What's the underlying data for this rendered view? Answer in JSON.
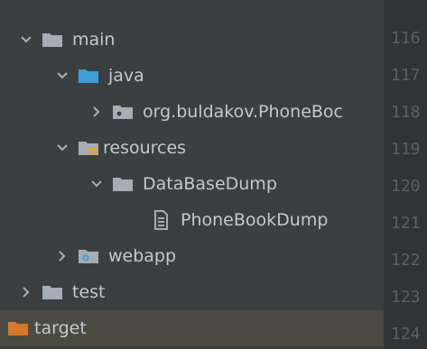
{
  "tree": {
    "items": [
      {
        "label": "main",
        "icon": "folder-icon",
        "state": "expanded"
      },
      {
        "label": "java",
        "icon": "source-folder-icon",
        "state": "expanded"
      },
      {
        "label": "org.buldakov.PhoneBoc",
        "icon": "package-icon",
        "state": "collapsed"
      },
      {
        "label": "resources",
        "icon": "resources-folder-icon",
        "state": "expanded"
      },
      {
        "label": "DataBaseDump",
        "icon": "folder-icon",
        "state": "expanded"
      },
      {
        "label": "PhoneBookDump",
        "icon": "file-icon",
        "state": "leaf"
      },
      {
        "label": "webapp",
        "icon": "web-folder-icon",
        "state": "collapsed"
      },
      {
        "label": "test",
        "icon": "folder-icon",
        "state": "collapsed"
      },
      {
        "label": "target",
        "icon": "excluded-folder-icon",
        "state": "leaf",
        "selected": true
      }
    ]
  },
  "gutter": {
    "line_numbers": [
      "116",
      "117",
      "118",
      "119",
      "120",
      "121",
      "122",
      "123",
      "124"
    ]
  },
  "colors": {
    "background": "#3c3f41",
    "gutter_background": "#313335",
    "text": "#c4c8cc",
    "line_number": "#5c6060",
    "folder": "#a5adb5",
    "source_folder": "#3d9fd8",
    "resource_lines": "#d7a636",
    "excluded_folder": "#d6782b",
    "selected_row": "#4b4b44"
  }
}
